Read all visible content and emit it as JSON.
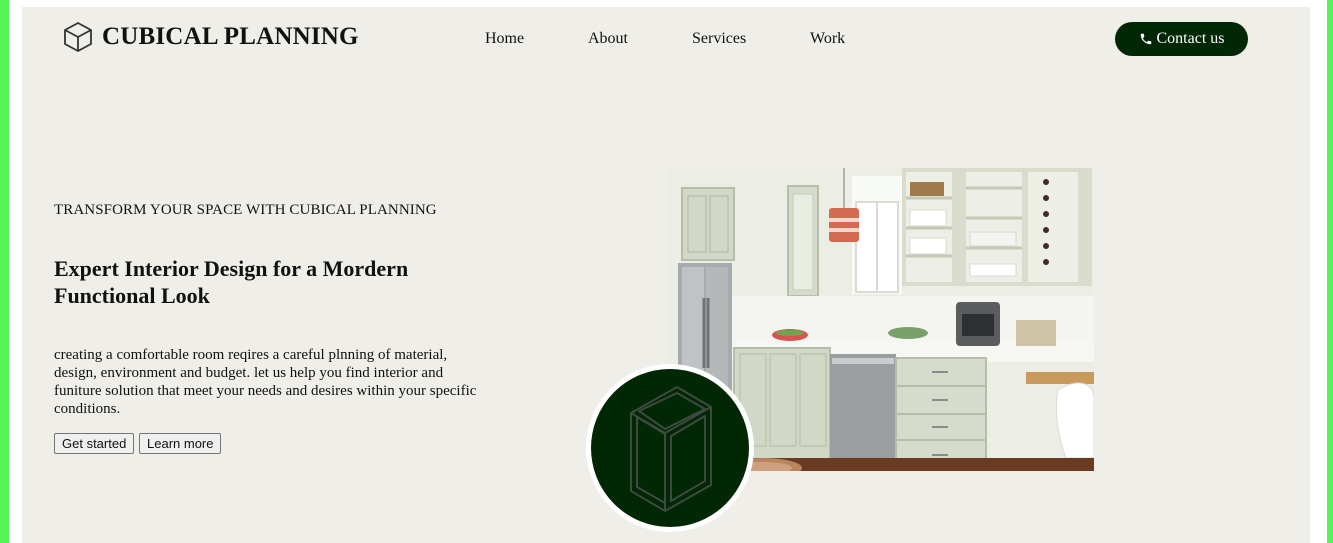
{
  "brand": {
    "name": "CUBICAL PLANNING",
    "icon": "cube-icon"
  },
  "nav": {
    "items": [
      {
        "label": "Home"
      },
      {
        "label": "About"
      },
      {
        "label": "Services"
      },
      {
        "label": "Work"
      }
    ],
    "contact": {
      "label": "Contact us",
      "icon": "phone-icon"
    }
  },
  "hero": {
    "eyebrow": "TRANSFORM YOUR SPACE WITH CUBICAL PLANNING",
    "headline": "Expert Interior Design for a Mordern Functional Look",
    "description": "creating a comfortable room reqires a careful plnning of material, design, environment and budget. let us help you find interior and funiture solution that meet your needs and desires within your specific conditions.",
    "primary_button": "Get started",
    "secondary_button": "Learn more",
    "image": "kitchen-photo",
    "badge_icon": "cube-icon"
  },
  "colors": {
    "background": "#efeee9",
    "accent": "#022705",
    "frame": "#57f257"
  }
}
